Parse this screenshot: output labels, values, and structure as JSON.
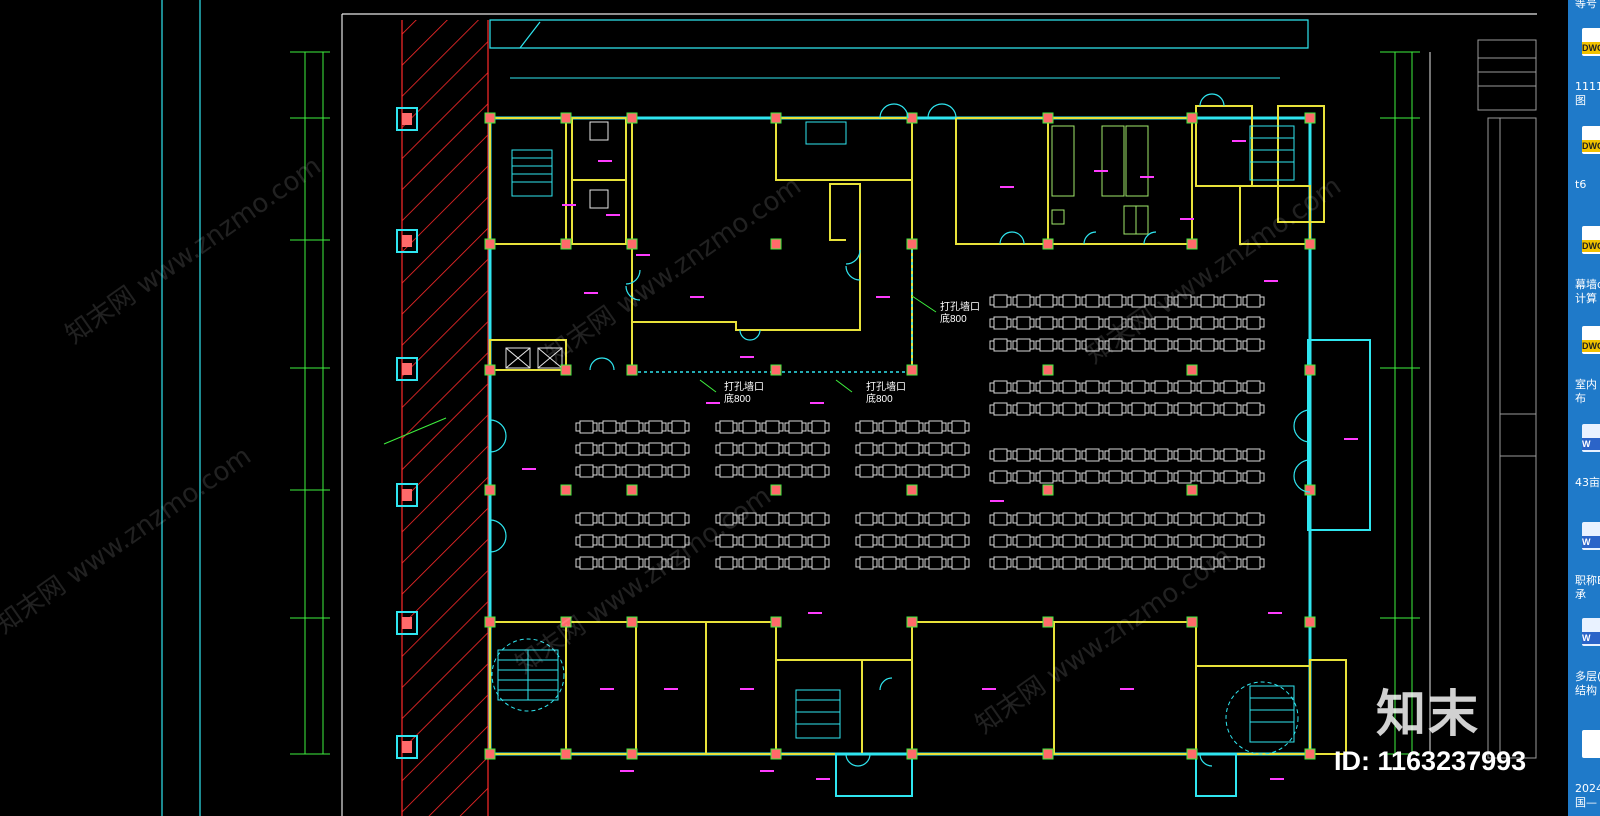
{
  "drawing": {
    "labels": {
      "opening_a": "打孔墙口",
      "opening_a_sub": "底800",
      "opening_b": "打孔墙口",
      "opening_b_sub": "底800",
      "opening_c": "打孔墙口",
      "opening_c_sub": "底800"
    }
  },
  "watermark": {
    "brand_text": "知末",
    "id_text": "ID: 1163237993",
    "repeat_text": "知末网 www.znzmo.com"
  },
  "dock": {
    "items": [
      {
        "type": "DWG",
        "label": "1111",
        "label2": "图",
        "icon": "dwg-file-icon"
      },
      {
        "type": "DWG",
        "label": "t6",
        "label2": "",
        "icon": "dwg-file-icon"
      },
      {
        "type": "DWG",
        "label": "幕墙d",
        "label2": "计算",
        "icon": "dwg-file-icon"
      },
      {
        "type": "DWG",
        "label": "室内",
        "label2": "布",
        "icon": "dwg-file-icon"
      },
      {
        "type": "W",
        "label": "43亩",
        "label2": "",
        "icon": "word-file-icon"
      },
      {
        "type": "W",
        "label": "职称E",
        "label2": "承",
        "icon": "word-file-icon"
      },
      {
        "type": "W",
        "label": "多层(",
        "label2": "结构",
        "icon": "word-file-icon"
      },
      {
        "type": "",
        "label": "2024",
        "label2": "国—",
        "icon": "file-icon"
      }
    ],
    "top_label": "等号"
  },
  "colors": {
    "wall": "#e8e23a",
    "glazing": "#2fe6f0",
    "dimension": "#3ef03e",
    "text_magenta": "#ff3cff",
    "furniture": "#e6e6e6",
    "hatch": "#ff2a2a",
    "column_fill": "#ff6a6a"
  }
}
